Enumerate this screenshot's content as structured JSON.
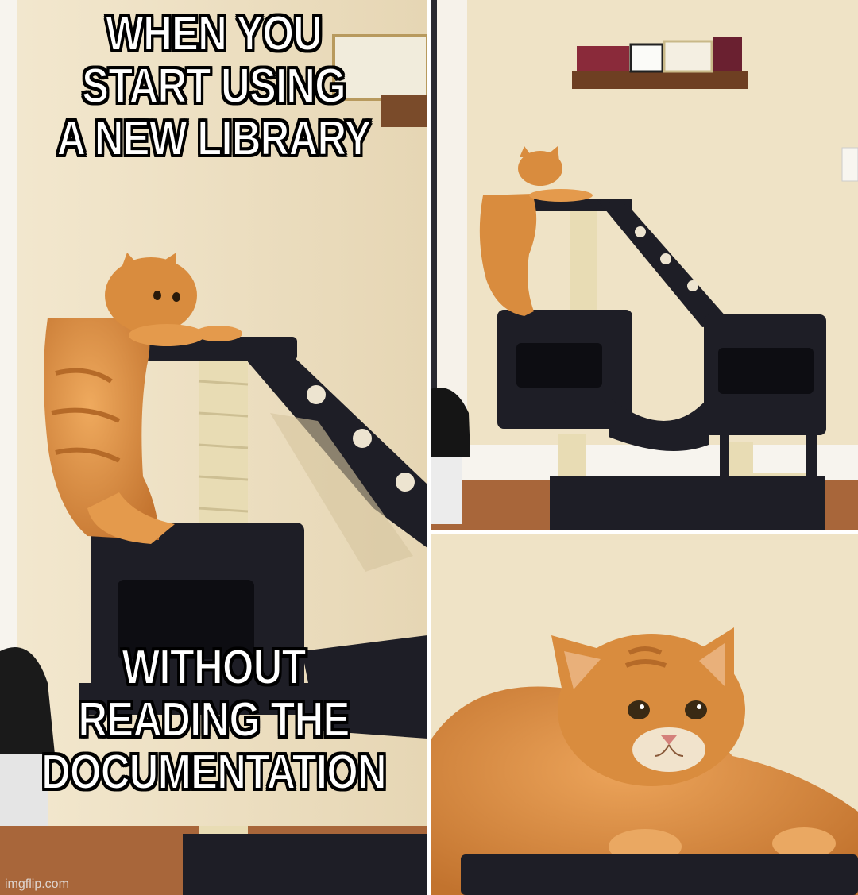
{
  "meme": {
    "top_caption": [
      "WHEN YOU",
      "START USING",
      "A NEW LIBRARY"
    ],
    "bottom_caption": [
      "WITHOUT",
      "READING THE",
      "DOCUMENTATION"
    ],
    "watermark": "imgflip.com"
  },
  "colors": {
    "wall": "#efe3c6",
    "fur": "#d98c3e",
    "tower_fabric": "#1e1e26",
    "sisal": "#e8dcb4",
    "floor": "#a8663a"
  }
}
